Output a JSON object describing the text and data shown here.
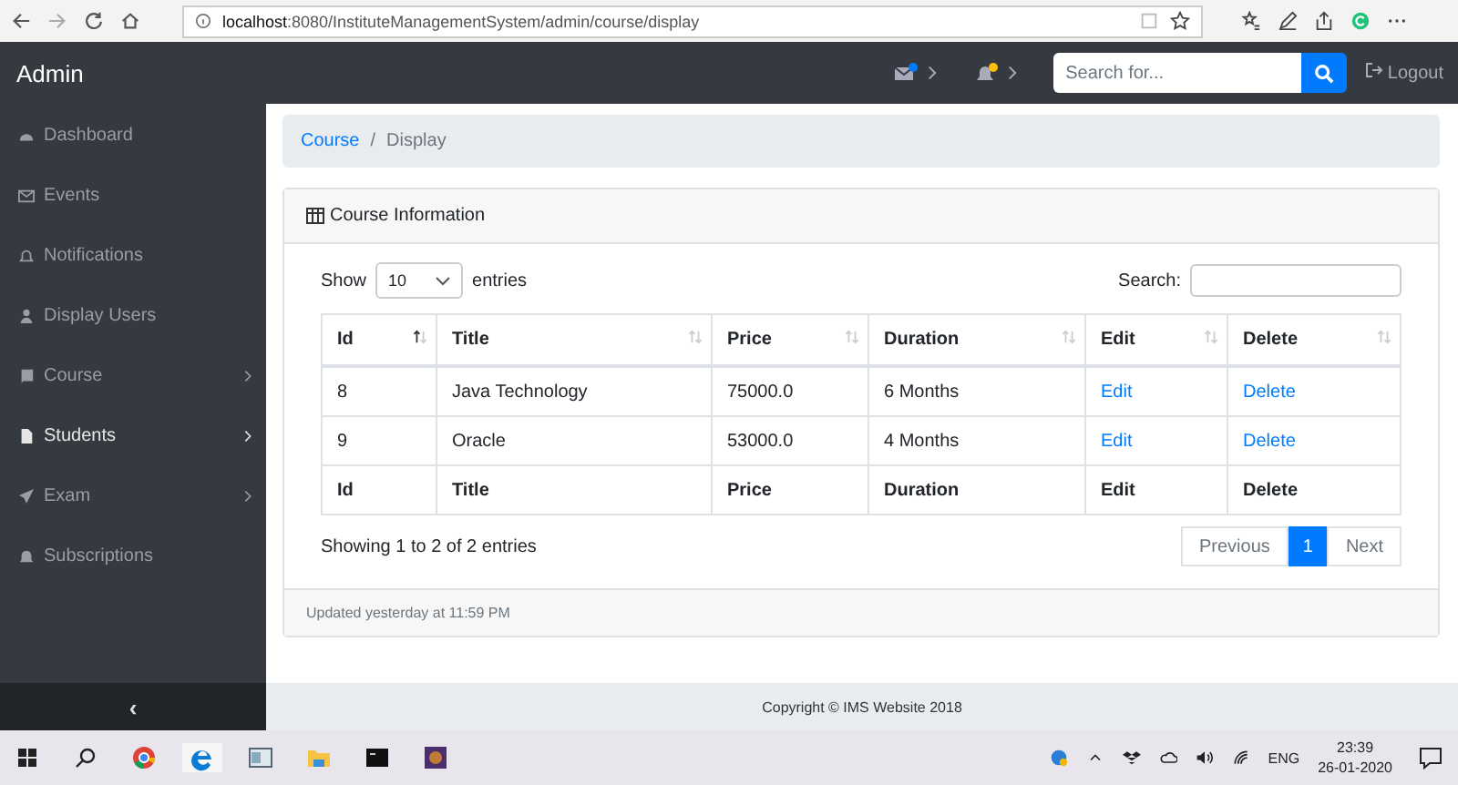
{
  "browser": {
    "url_host": "localhost",
    "url_path": ":8080/InstituteManagementSystem/admin/course/display"
  },
  "navbar": {
    "brand": "Admin",
    "alerts": [
      {
        "kind": "mail",
        "color": "#007bff"
      },
      {
        "kind": "bell",
        "color": "#ffc107"
      }
    ],
    "search": {
      "placeholder": "Search for..."
    },
    "logout": "Logout"
  },
  "sidebar": {
    "items": [
      {
        "kind": "dashboard",
        "label": "Dashboard",
        "selected": false,
        "submenu": false
      },
      {
        "kind": "mail",
        "label": "Events",
        "selected": false,
        "submenu": false
      },
      {
        "kind": "bell-outline",
        "label": "Notifications",
        "selected": false,
        "submenu": false
      },
      {
        "kind": "user",
        "label": "Display Users",
        "selected": false,
        "submenu": false
      },
      {
        "kind": "book",
        "label": "Course",
        "selected": false,
        "submenu": true
      },
      {
        "kind": "file",
        "label": "Students",
        "selected": true,
        "submenu": true
      },
      {
        "kind": "plane",
        "label": "Exam",
        "selected": false,
        "submenu": true
      },
      {
        "kind": "bell",
        "label": "Subscriptions",
        "selected": false,
        "submenu": false
      }
    ],
    "toggle": "‹"
  },
  "breadcrumb": {
    "separator": "/",
    "items": [
      {
        "label": "Course",
        "link": true
      },
      {
        "label": "Display",
        "link": false
      }
    ]
  },
  "card": {
    "title": "Course Information",
    "show_label": "Show",
    "page_size": "10",
    "entries_label": "entries",
    "search_label": "Search:",
    "table": {
      "columns": [
        {
          "label": "Id",
          "sorted": true
        },
        {
          "label": "Title",
          "sorted": false
        },
        {
          "label": "Price",
          "sorted": false
        },
        {
          "label": "Duration",
          "sorted": false
        },
        {
          "label": "Edit",
          "sorted": false
        },
        {
          "label": "Delete",
          "sorted": false
        }
      ],
      "rows": [
        [
          "8",
          "Java Technology",
          "75000.0",
          "6 Months",
          "Edit",
          "Delete"
        ],
        [
          "9",
          "Oracle",
          "53000.0",
          "4 Months",
          "Edit",
          "Delete"
        ]
      ],
      "footer": [
        "Id",
        "Title",
        "Price",
        "Duration",
        "Edit",
        "Delete"
      ]
    },
    "info": "Showing 1 to 2 of 2 entries",
    "pagination": [
      {
        "label": "Previous",
        "kind": "nav",
        "disabled": true,
        "selected": false
      },
      {
        "label": "1",
        "kind": "page",
        "disabled": false,
        "selected": true
      },
      {
        "label": "Next",
        "kind": "nav",
        "disabled": true,
        "selected": false
      }
    ],
    "updated": "Updated yesterday at 11:59 PM"
  },
  "footer": "Copyright © IMS Website 2018",
  "taskbar": {
    "language": "ENG",
    "time": "23:39",
    "date": "26-01-2020"
  }
}
